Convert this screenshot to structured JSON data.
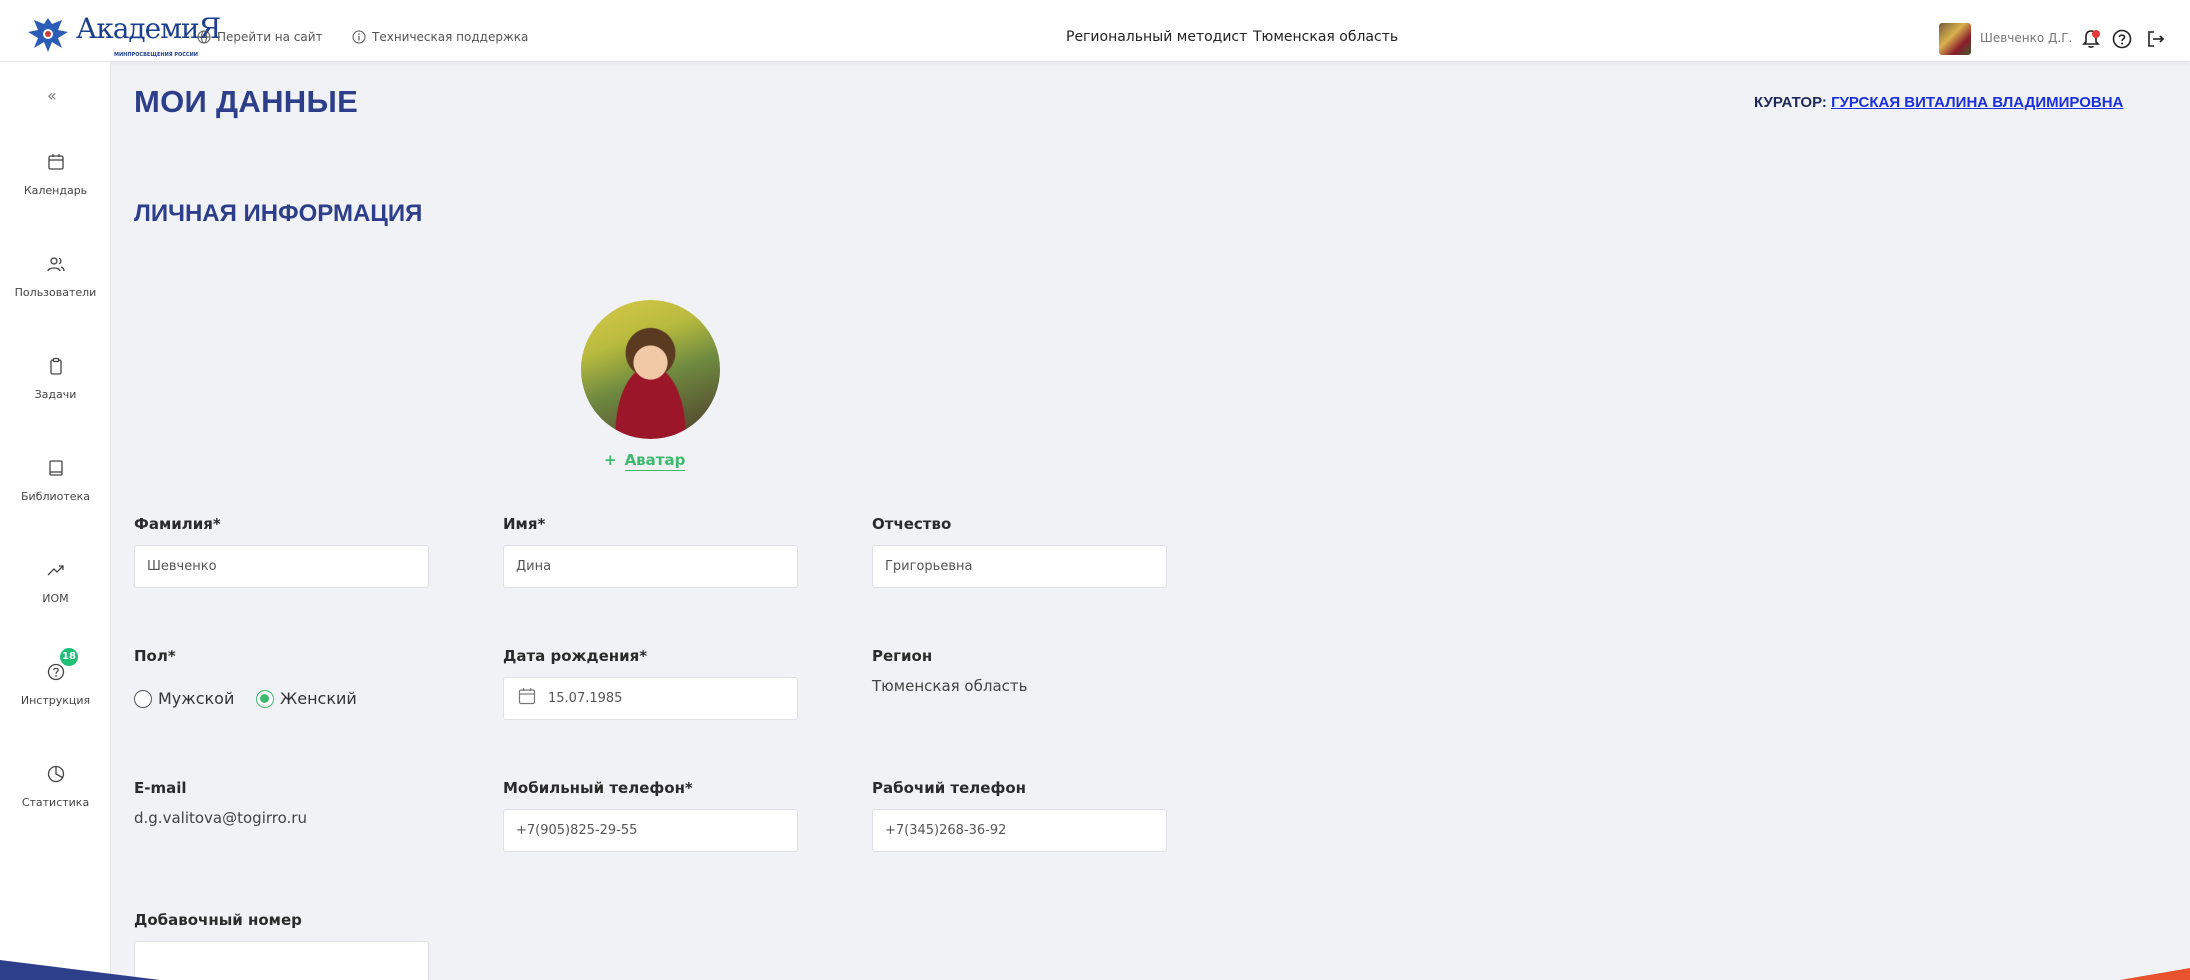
{
  "header": {
    "logo_text": "АкадемиЯ",
    "logo_subtext": "МИНПРОСВЕЩЕНИЯ РОССИИ",
    "site_link": "Перейти на сайт",
    "support_link": "Техническая поддержка",
    "role": "Региональный методист",
    "region": "Тюменская область",
    "user_name": "Шевченко Д.Г."
  },
  "sidebar": {
    "collapse": "«",
    "items": [
      {
        "label": "Календарь",
        "icon": "calendar-icon"
      },
      {
        "label": "Пользователи",
        "icon": "users-icon"
      },
      {
        "label": "Задачи",
        "icon": "clipboard-icon"
      },
      {
        "label": "Библиотека",
        "icon": "book-icon"
      },
      {
        "label": "ИОМ",
        "icon": "trend-icon"
      },
      {
        "label": "Инструкция",
        "icon": "question-icon",
        "badge": "18"
      },
      {
        "label": "Статистика",
        "icon": "pie-chart-icon"
      }
    ]
  },
  "page": {
    "title": "МОИ ДАННЫЕ",
    "curator_label": "КУРАТОР:",
    "curator_name": "ГУРСКАЯ ВИТАЛИНА ВЛАДИМИРОВНА",
    "section_title": "ЛИЧНАЯ ИНФОРМАЦИЯ",
    "avatar_plus": "+",
    "avatar_label": "Аватар"
  },
  "form": {
    "last_name": {
      "label": "Фамилия*",
      "value": "Шевченко"
    },
    "first_name": {
      "label": "Имя*",
      "value": "Дина"
    },
    "patronymic": {
      "label": "Отчество",
      "value": "Григорьевна"
    },
    "gender": {
      "label": "Пол*",
      "options": [
        "Мужской",
        "Женский"
      ],
      "selected": "Женский"
    },
    "birth_date": {
      "label": "Дата рождения*",
      "value": "15.07.1985"
    },
    "region": {
      "label": "Регион",
      "value": "Тюменская область"
    },
    "email": {
      "label": "E-mail",
      "value": "d.g.valitova@togirro.ru"
    },
    "mobile": {
      "label": "Мобильный телефон*",
      "value": "+7(905)825-29-55"
    },
    "work_phone": {
      "label": "Рабочий телефон",
      "value": "+7(345)268-36-92"
    },
    "extension": {
      "label": "Добавочный номер",
      "value": ""
    }
  },
  "colors": {
    "brand_blue": "#2d3e8a",
    "accent_green": "#3cba6e",
    "link_blue": "#1b2fdc",
    "badge_green": "#1fbf76"
  }
}
